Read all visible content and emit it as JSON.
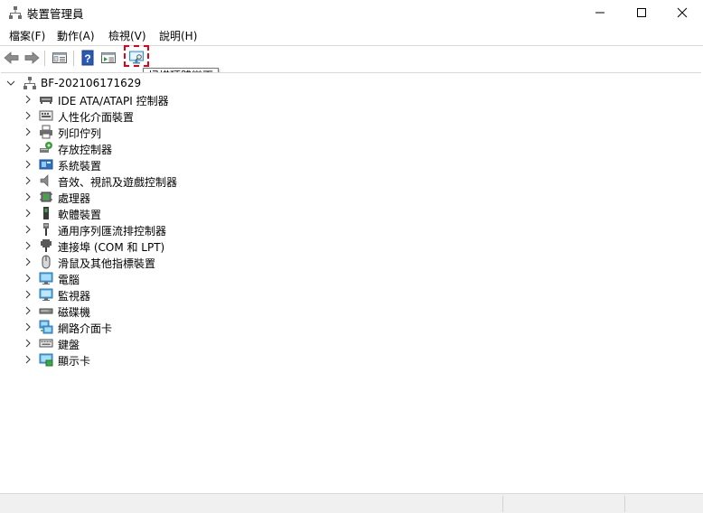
{
  "window": {
    "title": "裝置管理員"
  },
  "menu": [
    {
      "label": "檔案(F)"
    },
    {
      "label": "動作(A)"
    },
    {
      "label": "檢視(V)"
    },
    {
      "label": "說明(H)"
    }
  ],
  "toolbar": {
    "buttons": [
      "back-icon",
      "forward-icon",
      "properties-pane-icon",
      "help-icon",
      "update-driver-icon",
      "scan-hardware-icon"
    ],
    "tooltip": "掃描硬體變更",
    "highlight_color": "#e60012"
  },
  "tree": {
    "root": "BF-202106171629",
    "categories": [
      {
        "label": "IDE ATA/ATAPI 控制器",
        "icon": "ide-controller-icon"
      },
      {
        "label": "人性化介面裝置",
        "icon": "hid-icon"
      },
      {
        "label": "列印佇列",
        "icon": "printer-icon"
      },
      {
        "label": "存放控制器",
        "icon": "storage-controller-icon"
      },
      {
        "label": "系統裝置",
        "icon": "system-device-icon"
      },
      {
        "label": "音效、視訊及遊戲控制器",
        "icon": "sound-icon"
      },
      {
        "label": "處理器",
        "icon": "processor-icon"
      },
      {
        "label": "軟體裝置",
        "icon": "software-device-icon"
      },
      {
        "label": "通用序列匯流排控制器",
        "icon": "usb-icon"
      },
      {
        "label": "連接埠 (COM 和 LPT)",
        "icon": "port-icon"
      },
      {
        "label": "滑鼠及其他指標裝置",
        "icon": "mouse-icon"
      },
      {
        "label": "電腦",
        "icon": "computer-icon"
      },
      {
        "label": "監視器",
        "icon": "monitor-icon"
      },
      {
        "label": "磁碟機",
        "icon": "disk-drive-icon"
      },
      {
        "label": "網路介面卡",
        "icon": "network-adapter-icon"
      },
      {
        "label": "鍵盤",
        "icon": "keyboard-icon"
      },
      {
        "label": "顯示卡",
        "icon": "display-adapter-icon"
      }
    ]
  }
}
